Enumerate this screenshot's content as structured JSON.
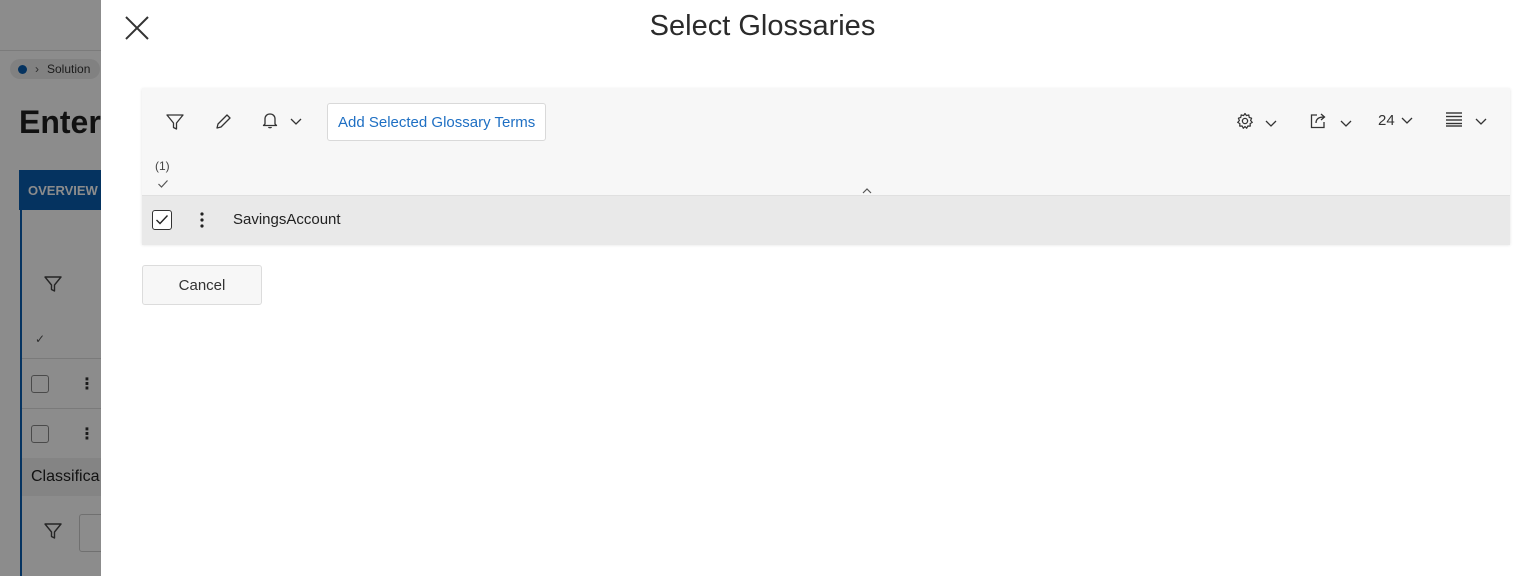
{
  "background": {
    "breadcrumb_label": "Solution",
    "page_title": "Enter",
    "tab_label": "OVERVIEW",
    "section_label": "Classifica"
  },
  "dialog": {
    "title": "Select Glossaries",
    "toolbar": {
      "add_selected_label": "Add Selected Glossary Terms",
      "page_size": "24"
    },
    "selection_count": "(1)",
    "rows": [
      {
        "name": "SavingsAccount",
        "checked": true
      }
    ],
    "cancel_label": "Cancel"
  },
  "colors": {
    "accent": "#0a5eb0",
    "link": "#1e6fc3"
  },
  "icons": [
    "close-icon",
    "filter-icon",
    "pencil-icon",
    "bell-icon",
    "gear-icon",
    "export-icon",
    "chevron-down-icon",
    "list-view-icon",
    "kebab-icon",
    "checkmark-icon",
    "sort-caret-icon"
  ]
}
